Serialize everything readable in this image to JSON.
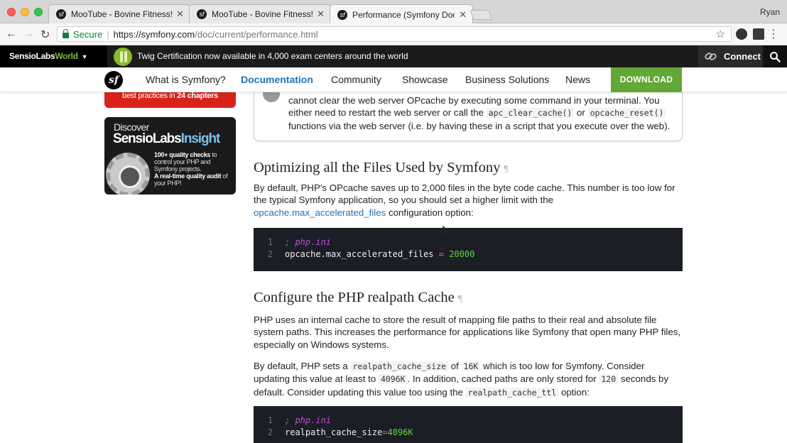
{
  "browser": {
    "tabs": [
      {
        "title": "MooTube - Bovine Fitness!"
      },
      {
        "title": "MooTube - Bovine Fitness!"
      },
      {
        "title": "Performance (Symfony Docs)"
      }
    ],
    "profile": "Ryan",
    "secure_label": "Secure",
    "url_host": "https://symfony.com",
    "url_path": "/doc/current/performance.html"
  },
  "sensiolabs_bar": {
    "brand_a": "SensioLabs",
    "brand_b": "World",
    "promo": "Twig Certification now available in 4,000 exam centers around the world",
    "connect": "Connect"
  },
  "nav": {
    "items": [
      "What is Symfony?",
      "Documentation",
      "Community",
      "Showcase",
      "Business Solutions",
      "News"
    ],
    "active": "Documentation",
    "download": "DOWNLOAD"
  },
  "sidebar": {
    "red_banner_prefix": "best practices in ",
    "red_banner_bold": "24 chapters",
    "insight_discover": "Discover",
    "insight_name_a": "SensioLabs",
    "insight_name_b": "Insight",
    "insight_line1": "100+ quality checks",
    "insight_line1_rest": " to control your PHP and Symfony projects.",
    "insight_line2": "A real-time quality audit",
    "insight_line2_rest": " of your PHP!"
  },
  "content": {
    "note_a": "cannot clear the web server OPcache by executing some command in your terminal. You either need to restart the web server or call the ",
    "note_code1": "apc_clear_cache()",
    "note_b": " or ",
    "note_code2": "opcache_reset()",
    "note_c": " functions via the web server (i.e. by having these in a script that you execute over the web).",
    "h1": "Optimizing all the Files Used by Symfony",
    "pilcrow": "¶",
    "p1_a": "By default, PHP's OPcache saves up to 2,000 files in the byte code cache. This number is too low for the typical Symfony application, so you should set a higher limit with the ",
    "p1_link": "opcache.max_accelerated_files",
    "p1_b": " configuration option:",
    "code1": {
      "line1_no": "1",
      "line1_comment": "; php.ini",
      "line2_no": "2",
      "line2_key": "opcache.max_accelerated_files ",
      "line2_op": "=",
      "line2_val": " 20000"
    },
    "h2": "Configure the PHP realpath Cache",
    "p2": "PHP uses an internal cache to store the result of mapping file paths to their real and absolute file system paths. This increases the performance for applications like Symfony that open many PHP files, especially on Windows systems.",
    "p3_a": "By default, PHP sets a ",
    "p3_code1": "realpath_cache_size",
    "p3_b": " of ",
    "p3_code2": "16K",
    "p3_c": " which is too low for Symfony. Consider updating this value at least to ",
    "p3_code3": "4096K",
    "p3_d": ". In addition, cached paths are only stored for ",
    "p3_code4": "120",
    "p3_e": " seconds by default. Consider updating this value too using the ",
    "p3_code5": "realpath_cache_ttl",
    "p3_f": " option:",
    "code2": {
      "line1_no": "1",
      "line1_comment": "; php.ini",
      "line2_no": "2",
      "line2_key": "realpath_cache_size",
      "line2_op": "=",
      "line2_val": "4096K"
    }
  }
}
